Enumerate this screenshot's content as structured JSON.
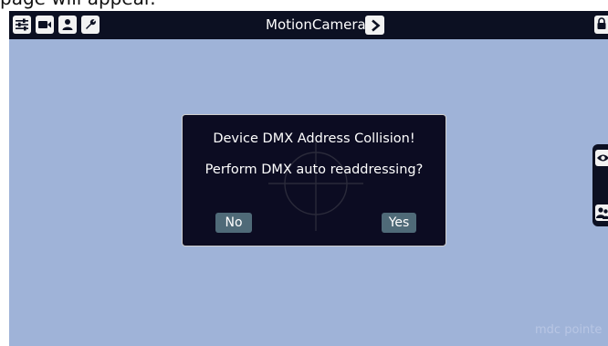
{
  "document": {
    "text_fragment": "page will appear."
  },
  "topbar": {
    "title": "MotionCamera",
    "icons": [
      "settings-sliders-icon",
      "video-camera-icon",
      "person-icon",
      "wrench-icon"
    ],
    "title_arrow_icon": "chevron-right-icon",
    "lock_icon": "lock-icon"
  },
  "side_panel": {
    "icons": [
      "eye-icon",
      "group-icon"
    ]
  },
  "dialog": {
    "line1": "Device DMX Address Collision!",
    "line2": "Perform DMX auto readdressing?",
    "no_label": "No",
    "yes_label": "Yes"
  },
  "watermark": "mdc pointe",
  "colors": {
    "background": "#9fb3d8",
    "topbar": "#0c1022",
    "dialog": "#0c0c22",
    "button": "#4f6a78"
  }
}
